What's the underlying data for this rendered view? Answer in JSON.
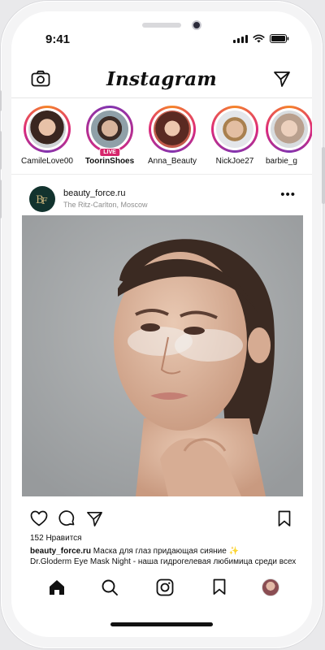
{
  "status_bar": {
    "time": "9:41"
  },
  "app": {
    "brand": "Instagram"
  },
  "stories": [
    {
      "name": "CamileLove00",
      "live": false,
      "bold": false
    },
    {
      "name": "ToorinShoes",
      "live": true,
      "bold": true
    },
    {
      "name": "Anna_Beauty",
      "live": false,
      "bold": false
    },
    {
      "name": "NickJoe27",
      "live": false,
      "bold": false
    },
    {
      "name": "barbie_g",
      "live": false,
      "bold": false
    }
  ],
  "live_badge": "LIVE",
  "post": {
    "username": "beauty_force.ru",
    "location": "The Ritz-Carlton, Moscow",
    "likes": "152 Нравится",
    "caption_user": "beauty_force.ru",
    "caption_line1": " Маска для глаз придающая сияние ✨",
    "caption_line2": "Dr.Gloderm Eye Mask Night - наша гидрогелевая любимица среди всех"
  },
  "icons": {
    "camera": "camera-icon",
    "send": "direct-send-icon",
    "more": "more-options-icon",
    "like": "heart-icon",
    "comment": "comment-icon",
    "share": "share-icon",
    "save": "bookmark-icon",
    "home": "home-icon",
    "search": "search-icon",
    "reels": "reels-icon",
    "saved": "saved-bookmark-icon",
    "profile": "profile-avatar-icon"
  },
  "colors": {
    "story_ring": "#dd2a7b",
    "live_badge": "#d6266b",
    "text": "#111111",
    "secondary_text": "#8e8e8e"
  }
}
